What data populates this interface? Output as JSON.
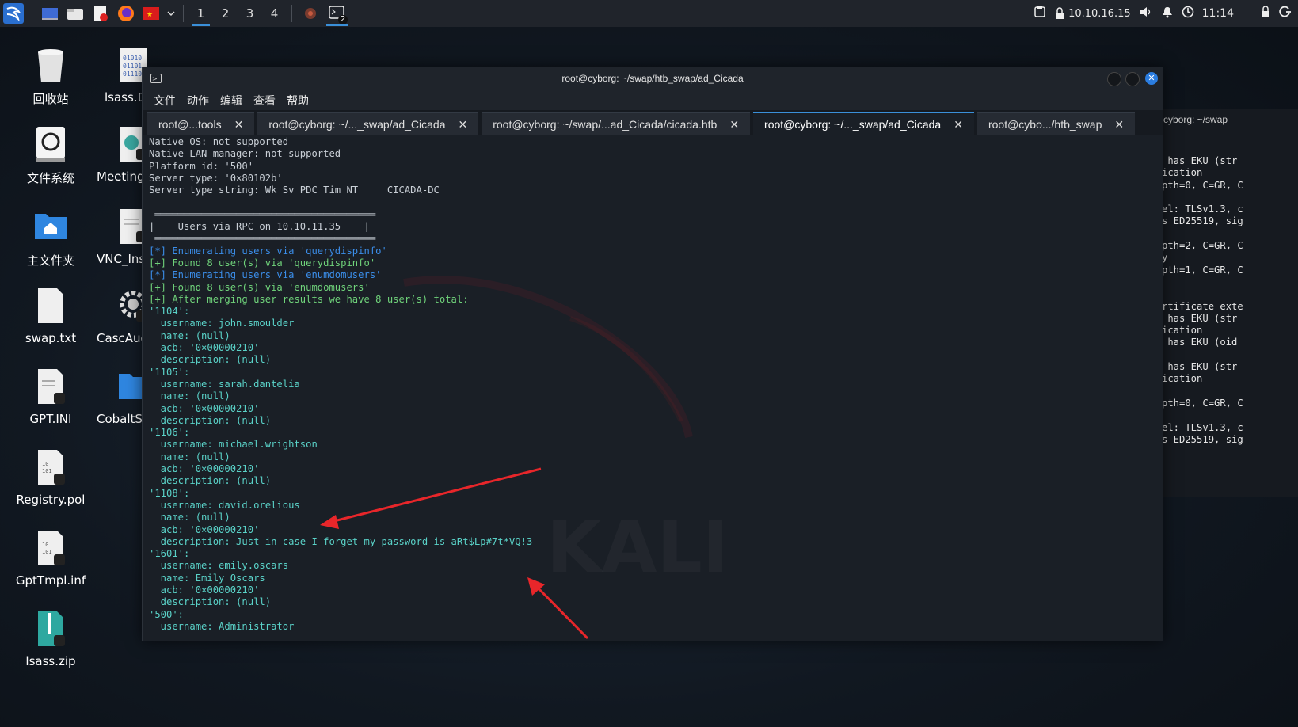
{
  "panel": {
    "workspaces": [
      "1",
      "2",
      "3",
      "4"
    ],
    "terminal_badge": "2",
    "ip": "10.10.16.15",
    "time": "11:14"
  },
  "desktop": {
    "icons": [
      {
        "label": "回收站"
      },
      {
        "label": "lsass.D"
      },
      {
        "label": "文件系统"
      },
      {
        "label": "Meeting_"
      },
      {
        "label": "主文件夹"
      },
      {
        "label": "VNC_Inst"
      },
      {
        "label": "swap.txt"
      },
      {
        "label": "CascAudi"
      },
      {
        "label": "GPT.INI"
      },
      {
        "label": "CobaltStr"
      },
      {
        "label": "Registry.pol"
      },
      {
        "label": "GptTmpl.inf"
      },
      {
        "label": "lsass.zip"
      }
    ],
    "watermark": "KALI"
  },
  "window": {
    "title": "root@cyborg: ~/swap/htb_swap/ad_Cicada",
    "menu": [
      "文件",
      "动作",
      "编辑",
      "查看",
      "帮助"
    ],
    "tabs": [
      {
        "label": "root@...tools",
        "close": "✕"
      },
      {
        "label": "root@cyborg: ~/..._swap/ad_Cicada",
        "close": "✕"
      },
      {
        "label": "root@cyborg: ~/swap/...ad_Cicada/cicada.htb",
        "close": "✕"
      },
      {
        "label": "root@cyborg: ~/..._swap/ad_Cicada",
        "close": "✕"
      },
      {
        "label": "root@cybo.../htb_swap",
        "close": "✕"
      }
    ]
  },
  "terminal_lines": [
    "Native OS: not supported",
    "Native LAN manager: not supported",
    "Platform id: '500'",
    "Server type: '0×80102b'",
    "Server type string: Wk Sv PDC Tim NT     CICADA-DC",
    "",
    " ══════════════════════════════════════",
    "|    Users via RPC on 10.10.11.35    |",
    " ══════════════════════════════════════",
    "[*] Enumerating users via 'querydispinfo'",
    "[+] Found 8 user(s) via 'querydispinfo'",
    "[*] Enumerating users via 'enumdomusers'",
    "[+] Found 8 user(s) via 'enumdomusers'",
    "[+] After merging user results we have 8 user(s) total:",
    "'1104':",
    "  username: john.smoulder",
    "  name: (null)",
    "  acb: '0×00000210'",
    "  description: (null)",
    "'1105':",
    "  username: sarah.dantelia",
    "  name: (null)",
    "  acb: '0×00000210'",
    "  description: (null)",
    "'1106':",
    "  username: michael.wrightson",
    "  name: (null)",
    "  acb: '0×00000210'",
    "  description: (null)",
    "'1108':",
    "  username: david.orelious",
    "  name: (null)",
    "  acb: '0×00000210'",
    "  description: Just in case I forget my password is aRt$Lp#7t*VQ!3",
    "'1601':",
    "  username: emily.oscars",
    "  name: Emily Oscars",
    "  acb: '0×00000210'",
    "  description: (null)",
    "'500':",
    "  username: Administrator"
  ],
  "line_styles": [
    "",
    "",
    "",
    "",
    "",
    "",
    "",
    "",
    "",
    "blue",
    "green",
    "blue",
    "green",
    "green",
    "",
    "",
    "",
    "",
    "",
    "",
    "",
    "",
    "",
    "",
    "",
    "",
    "",
    "",
    "",
    "",
    "",
    "",
    "",
    "",
    "",
    "",
    "",
    "",
    "",
    "",
    ""
  ],
  "background_terminal": {
    "title_fragment": "cyborg: ~/swap",
    "lines": [
      " has EKU (str",
      "ication",
      "pth=0, C=GR, C",
      "",
      "el: TLSv1.3, c",
      "s ED25519, sig",
      "",
      "pth=2, C=GR, C",
      "y",
      "pth=1, C=GR, C",
      "",
      "",
      "rtificate exte",
      " has EKU (str",
      "ication",
      " has EKU (oid",
      "",
      " has EKU (str",
      "ication",
      "",
      "pth=0, C=GR, C",
      "",
      "el: TLSv1.3, c",
      "s ED25519, sig"
    ]
  },
  "colors": {
    "terminal_bg": "#1a1f26",
    "accent": "#3a8fd8",
    "info_blue": "#3b8eea",
    "ok_green": "#6fd27a",
    "arrow_red": "#e8262a"
  }
}
